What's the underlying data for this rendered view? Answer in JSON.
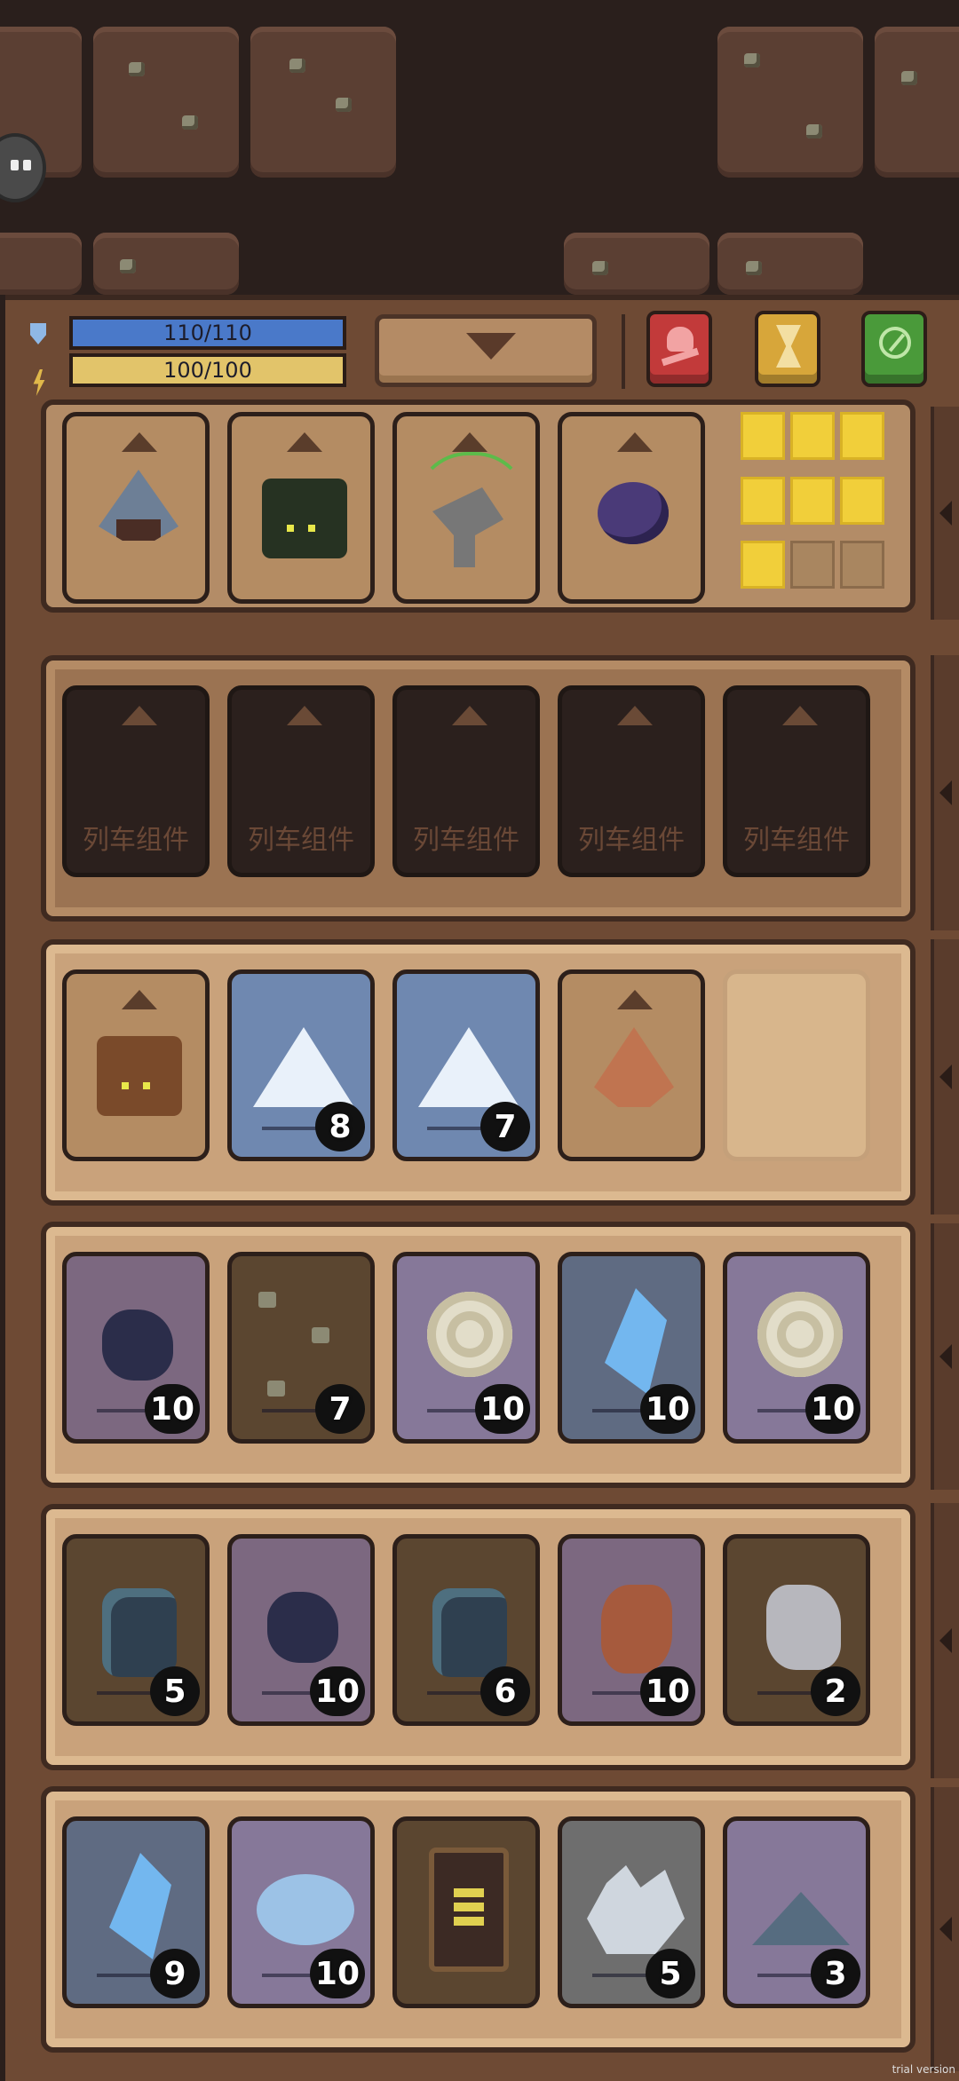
{
  "hud": {
    "hp_text": "110/110",
    "hp_fraction": 1.0,
    "energy_text": "100/100",
    "energy_fraction": 1.0,
    "buttons": [
      "skull-icon",
      "hourglass-icon",
      "compass-icon"
    ]
  },
  "equipment_row": {
    "cards": [
      {
        "icon": "pyramid-drill-icon"
      },
      {
        "icon": "drill-head-icon"
      },
      {
        "icon": "radar-dish-icon"
      },
      {
        "icon": "orb-icon"
      }
    ],
    "grid_slots_active": 7,
    "grid_slots_total": 9
  },
  "train_row": {
    "slot_label": "列车组件",
    "slots": 5
  },
  "inventory_rows": [
    [
      {
        "icon": "rusty-drill-icon",
        "count": ""
      },
      {
        "icon": "snow-icon",
        "count": "8"
      },
      {
        "icon": "snow-icon",
        "count": "7"
      },
      {
        "icon": "copper-pyramid-icon",
        "count": ""
      },
      {
        "icon": "empty",
        "count": ""
      }
    ],
    [
      {
        "icon": "coal-icon",
        "count": "10"
      },
      {
        "icon": "dirt-icon",
        "count": "7"
      },
      {
        "icon": "spiral-fossil-icon",
        "count": "10"
      },
      {
        "icon": "blue-crystal-icon",
        "count": "10"
      },
      {
        "icon": "spiral-fossil-icon",
        "count": "10"
      }
    ],
    [
      {
        "icon": "stone-icon",
        "count": "5"
      },
      {
        "icon": "coal-icon",
        "count": "10"
      },
      {
        "icon": "stone-icon",
        "count": "6"
      },
      {
        "icon": "copper-ore-icon",
        "count": "10"
      },
      {
        "icon": "silver-ore-icon",
        "count": "2"
      }
    ],
    [
      {
        "icon": "blue-crystal-icon",
        "count": "9"
      },
      {
        "icon": "gem-icon",
        "count": "10"
      },
      {
        "icon": "battery-icon",
        "count": ""
      },
      {
        "icon": "quartz-icon",
        "count": "5"
      },
      {
        "icon": "powder-icon",
        "count": "3"
      }
    ]
  ],
  "watermark": "trial version"
}
